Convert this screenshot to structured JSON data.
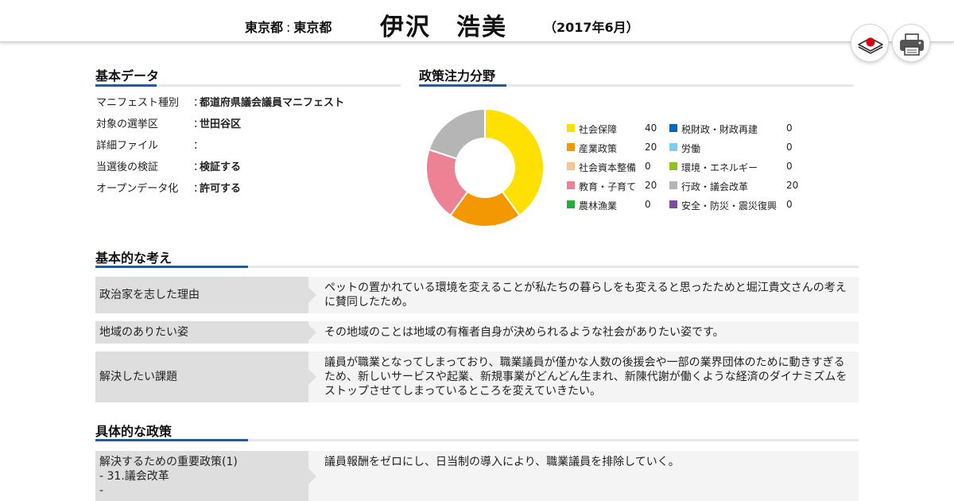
{
  "header": {
    "prefecture": "東京都",
    "separator": ":",
    "assembly": "東京都",
    "name": "伊沢　浩美",
    "date": "（2017年6月）"
  },
  "toolbar": {
    "action_icon": "layers-record-icon",
    "print_icon": "printer-icon"
  },
  "basic_data": {
    "title": "基本データ",
    "items": [
      {
        "key": "マニフェスト種別",
        "colon": "：",
        "value": "都道府県議会議員マニフェスト"
      },
      {
        "key": "対象の選挙区",
        "colon": "：",
        "value": "世田谷区"
      },
      {
        "key": "詳細ファイル",
        "colon": "：",
        "value": ""
      },
      {
        "key": "当選後の検証",
        "colon": "：",
        "value": "検証する"
      },
      {
        "key": "オープンデータ化",
        "colon": "：",
        "value": "許可する"
      }
    ]
  },
  "policy_focus": {
    "title": "政策注力分野"
  },
  "chart_data": {
    "type": "pie",
    "donut": true,
    "categories": [
      "社会保障",
      "産業政策",
      "社会資本整備",
      "教育・子育て",
      "農林漁業",
      "税財政・財政再建",
      "労働",
      "環境・エネルギー",
      "行政・議会改革",
      "安全・防災・震災復興"
    ],
    "values": [
      40,
      20,
      0,
      20,
      0,
      0,
      0,
      0,
      20,
      0
    ],
    "colors": [
      "#ffe000",
      "#f39800",
      "#f5c48f",
      "#ed8294",
      "#22ac38",
      "#0068b7",
      "#7ecef4",
      "#8fc31f",
      "#b5b5b5",
      "#7d4c9e"
    ],
    "legend": "right"
  },
  "basic_ideas": {
    "title": "基本的な考え",
    "rows": [
      {
        "label": "政治家を志した理由",
        "text": "ペットの置かれている環境を変えることが私たちの暮らしをも変えると思ったためと堀江貴文さんの考えに賛同したため。"
      },
      {
        "label": "地域のありたい姿",
        "text": "その地域のことは地域の有権者自身が決められるような社会がありたい姿です。"
      },
      {
        "label": "解決したい課題",
        "text": "議員が職業となってしまっており、職業議員が僅かな人数の後援会や一部の業界団体のために動きすぎるため、新しいサービスや起業、新規事業がどんどん生まれ、新陳代謝が働くような経済のダイナミズムをストップさせてしまっているところを変えていきたい。"
      }
    ]
  },
  "specific_policies": {
    "title": "具体的な政策",
    "rows": [
      {
        "label": "解決するための重要政策(1)\n- 31.議会改革\n-",
        "text": "議員報酬をゼロにし、日当制の導入により、職業議員を排除していく。"
      }
    ]
  }
}
